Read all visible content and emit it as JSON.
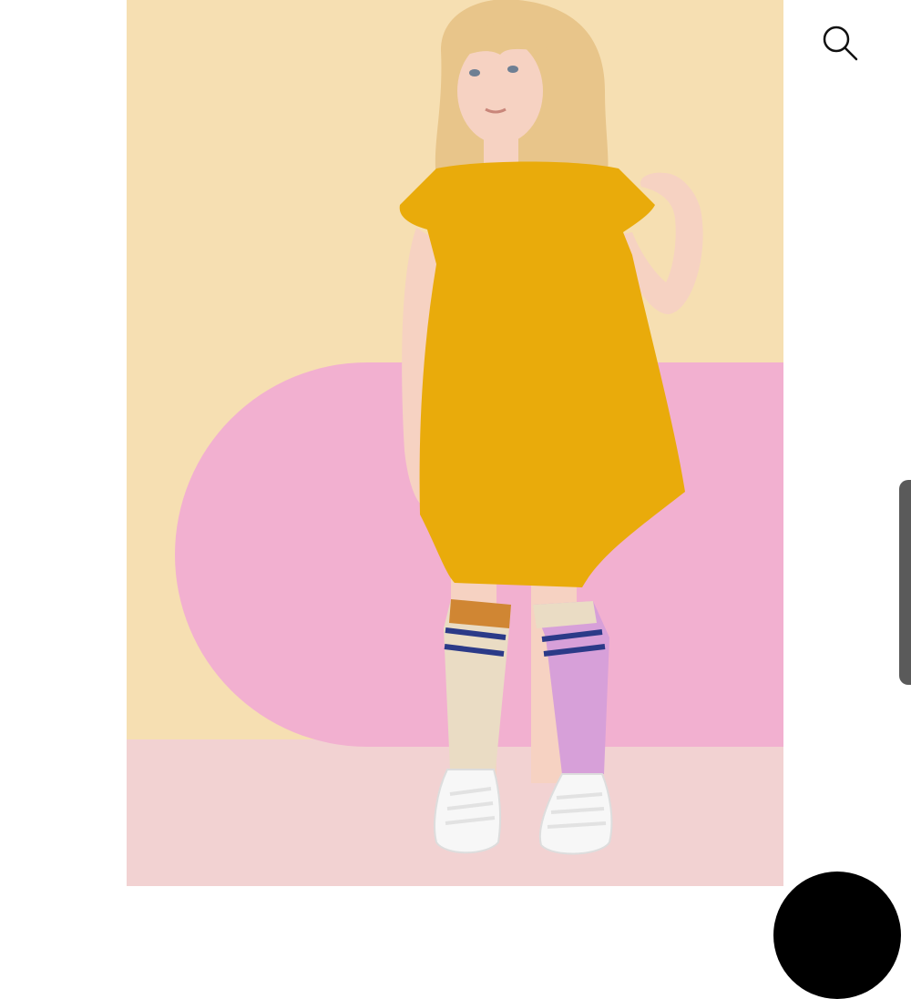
{
  "product_image": {
    "alt": "",
    "colors": {
      "wall": "#f6dfb2",
      "floor": "#f2d2d2",
      "pink_shape": "#f2b0d0",
      "dress": "#e9ab0b",
      "hair": "#e8c58a",
      "skin": "#f6d2c2",
      "sock_left": "#eadcc4",
      "sock_right": "#d7a0d9",
      "sock_stripe": "#2b3a88",
      "sock_cuff": "#d08633",
      "shoe": "#f7f7f7"
    }
  },
  "header": {
    "search_icon": "search-icon"
  },
  "side_scroll_handle": {
    "icon": "scroll-handle"
  },
  "floating_action": {
    "icon": "circle-button"
  }
}
